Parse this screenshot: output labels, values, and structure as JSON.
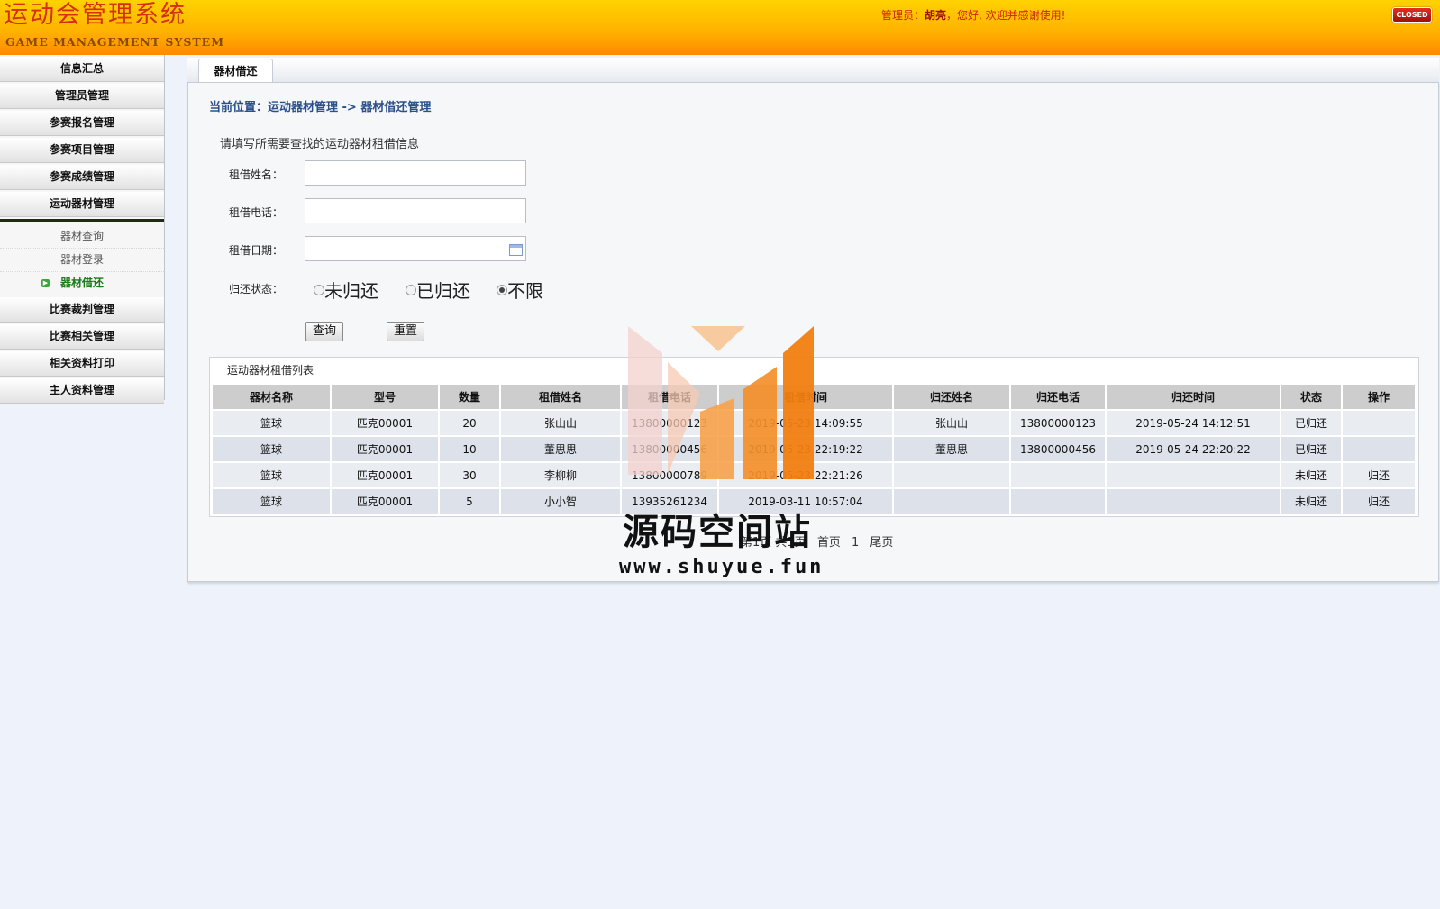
{
  "header": {
    "title": "运动会管理系统",
    "subtitle": "GAME MANAGEMENT SYSTEM",
    "welcome_prefix": "管理员：",
    "admin_name": "胡亮",
    "welcome_suffix": "，您好, 欢迎并感谢使用!",
    "closed_label": "CLOSED"
  },
  "sidebar": {
    "items_top": [
      {
        "label": "信息汇总"
      },
      {
        "label": "管理员管理"
      },
      {
        "label": "参赛报名管理"
      },
      {
        "label": "参赛项目管理"
      },
      {
        "label": "参赛成绩管理"
      },
      {
        "label": "运动器材管理"
      }
    ],
    "sub_items": [
      {
        "label": "器材查询"
      },
      {
        "label": "器材登录"
      },
      {
        "label": "器材借还"
      }
    ],
    "items_bottom": [
      {
        "label": "比赛裁判管理"
      },
      {
        "label": "比赛相关管理"
      },
      {
        "label": "相关资料打印"
      },
      {
        "label": "主人资料管理"
      }
    ]
  },
  "tab": {
    "label": "器材借还"
  },
  "breadcrumb": "当前位置：运动器材管理 -> 器材借还管理",
  "search": {
    "hint": "请填写所需要查找的运动器材租借信息",
    "name_label": "租借姓名：",
    "phone_label": "租借电话：",
    "date_label": "租借日期：",
    "status_label": "归还状态：",
    "name_value": "",
    "phone_value": "",
    "date_value": "",
    "status_options": [
      "未归还",
      "已归还",
      "不限"
    ],
    "status_selected": "不限",
    "query_button": "查询",
    "reset_button": "重置"
  },
  "list": {
    "title": "运动器材租借列表",
    "columns": [
      "器材名称",
      "型号",
      "数量",
      "租借姓名",
      "租借电话",
      "租借时间",
      "归还姓名",
      "归还电话",
      "归还时间",
      "状态",
      "操作"
    ],
    "rows": [
      [
        "篮球",
        "匹克00001",
        "20",
        "张山山",
        "13800000123",
        "2019-05-23 14:09:55",
        "张山山",
        "13800000123",
        "2019-05-24 14:12:51",
        "已归还",
        ""
      ],
      [
        "篮球",
        "匹克00001",
        "10",
        "董思思",
        "13800000456",
        "2019-05-23 22:19:22",
        "董思思",
        "13800000456",
        "2019-05-24 22:20:22",
        "已归还",
        ""
      ],
      [
        "篮球",
        "匹克00001",
        "30",
        "李柳柳",
        "13800000789",
        "2019-05-23 22:21:26",
        "",
        "",
        "",
        "未归还",
        "归还"
      ],
      [
        "篮球",
        "匹克00001",
        "5",
        "小小智",
        "13935261234",
        "2019-03-11 10:57:04",
        "",
        "",
        "",
        "未归还",
        "归还"
      ]
    ]
  },
  "pager": {
    "info": "第1页 共1页",
    "first": "首页",
    "current": "1",
    "last": "尾页"
  },
  "watermark": {
    "text": "源码空间站",
    "url": "www.shuyue.fun"
  }
}
